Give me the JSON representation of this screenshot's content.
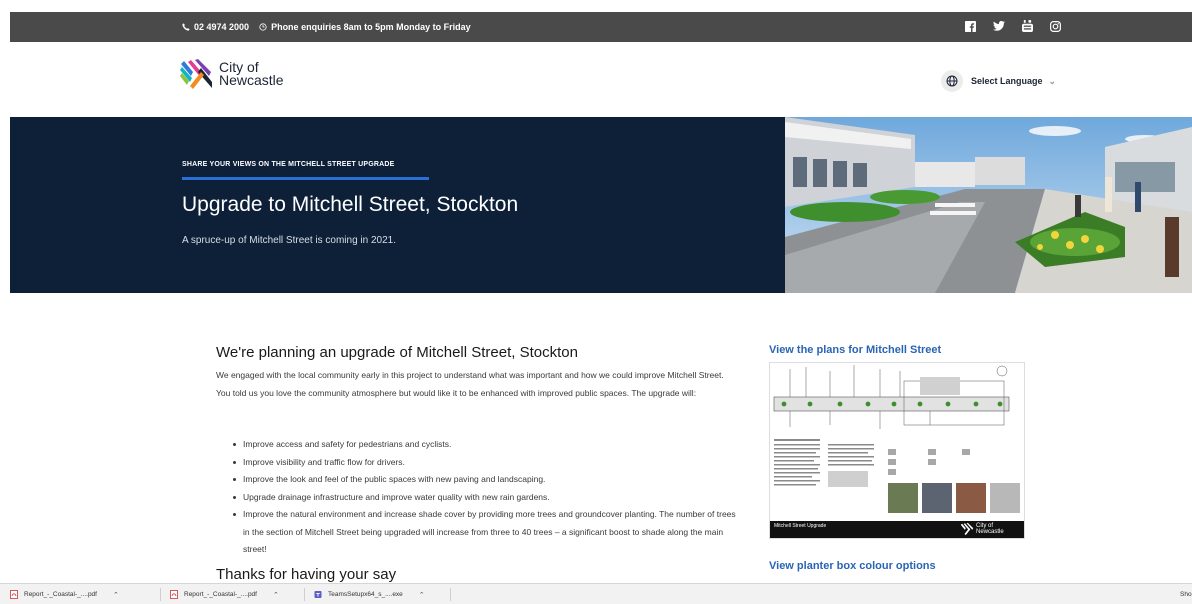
{
  "topbar": {
    "phone": "02 4974 2000",
    "hours": "Phone enquiries 8am to 5pm Monday to Friday",
    "social_icons": [
      "facebook-icon",
      "twitter-icon",
      "youtube-icon",
      "instagram-icon"
    ]
  },
  "header": {
    "logo_line1": "City of",
    "logo_line2": "Newcastle",
    "language_label": "Select Language"
  },
  "hero": {
    "eyebrow": "SHARE YOUR VIEWS ON THE MITCHELL STREET UPGRADE",
    "title": "Upgrade to Mitchell Street, Stockton",
    "subtitle": "A spruce-up of Mitchell Street is coming in 2021."
  },
  "main": {
    "heading": "We're planning an upgrade of Mitchell Street, Stockton",
    "intro": "We engaged with the local community early in this project to understand what was important and how we could improve Mitchell Street. You told us you love the community atmosphere but would like it to be enhanced with improved public spaces. The upgrade will:",
    "bullets": [
      "Improve access and safety for pedestrians and cyclists.",
      "Improve visibility and traffic flow for drivers.",
      "Improve the look and feel of the public spaces with new paving and landscaping.",
      "Upgrade drainage infrastructure and improve water quality with new rain gardens.",
      "Improve the natural environment and increase shade cover by providing more trees and groundcover planting. The number of trees in the section of Mitchell Street being upgraded will increase from three to 40 trees – a significant boost to shade along the main street!"
    ],
    "thanks_heading": "Thanks for having your say"
  },
  "sidebar": {
    "plans_link": "View the plans for Mitchell Street",
    "plan_caption": "Mitchell Street Upgrade",
    "plan_logo_line1": "City of",
    "plan_logo_line2": "Newcastle",
    "planter_link": "View planter box colour options"
  },
  "downloads": {
    "items": [
      {
        "name": "Report_-_Coastal-_....pdf",
        "icon": "pdf-icon"
      },
      {
        "name": "Report_-_Coastal-_....pdf",
        "icon": "pdf-icon"
      },
      {
        "name": "TeamsSetupx64_s_....exe",
        "icon": "teams-icon"
      }
    ],
    "show_all": "Sho"
  },
  "colors": {
    "topbar": "#4a4a4a",
    "hero": "#0d2038",
    "accent": "#2a6fd6",
    "link": "#2a64b4"
  }
}
